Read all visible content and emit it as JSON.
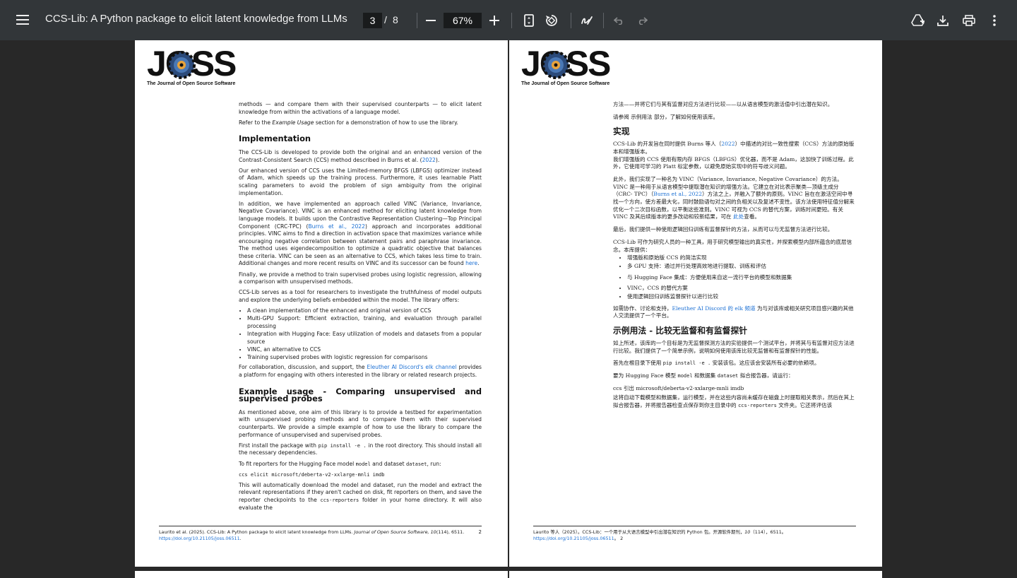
{
  "toolbar": {
    "title": "CCS-Lib: A Python package to elicit latent knowledge from LLMs",
    "page_current": "3",
    "page_sep": "/",
    "page_total": "8",
    "zoom": "67%"
  },
  "logo": {
    "letters": "JOSS",
    "subtitle": "The Journal of Open Source Software"
  },
  "en": {
    "intro_p1": "methods — and compare them with their supervised counterparts — to elicit latent knowledge from within the activations of a language model.",
    "intro_p2_a": "Refer to the ",
    "intro_p2_em": "Example Usage",
    "intro_p2_b": " section for a demonstration of how to use the library.",
    "h_impl": "Implementation",
    "impl_p1_a": "The CCS-Lib is developed to provide both the original and an enhanced version of the Contrast-Consistent Search (CCS) method described in Burns et al. (",
    "impl_p1_link": "2022",
    "impl_p1_b": ").",
    "impl_p2": "Our enhanced version of CCS uses the Limited-memory BFGS (LBFGS) optimizer instead of Adam, which speeds up the training process. Furthermore, it uses learnable Platt scaling parameters to avoid the problem of sign ambiguity from the original implementation.",
    "impl_p3_a": "In addition, we have implemented an approach called VINC (Variance, Invariance, Negative Covariance). VINC is an enhanced method for eliciting latent knowledge from language models. It builds upon the Contrastive Representation Clustering—Top Principal Component (CRC-TPC) (",
    "impl_p3_link": "Burns et al., 2022",
    "impl_p3_b": ") approach and incorporates additional principles. VINC aims to find a direction in activation space that maximizes variance while encouraging negative correlation between statement pairs and paraphrase invariance. The method uses eigendecomposition to optimize a quadratic objective that balances these criteria. VINC can be seen as an alternative to CCS, which takes less time to train. Additional changes and more recent results on VINC and its successor can be found ",
    "impl_p3_link2": "here",
    "impl_p3_c": ".",
    "impl_p4": "Finally, we provide a method to train supervised probes using logistic regression, allowing a comparison with unsupervised methods.",
    "impl_p5": "CCS-Lib serves as a tool for researchers to investigate the truthfulness of model outputs and explore the underlying beliefs embedded within the model. The library offers:",
    "bullets": [
      "A clean implementation of the enhanced and original version of CCS",
      "Multi-GPU Support: Efficient extraction, training, and evaluation through parallel processing",
      "Integration with Hugging Face: Easy utilization of models and datasets from a popular source",
      "VINC, an alternative to CCS",
      "Training supervised probes with logistic regression for comparisons"
    ],
    "collab_a": "For collaboration, discussion, and support, the ",
    "collab_link": "Eleuther AI Discord's elk channel",
    "collab_b": " provides a platform for engaging with others interested in the library or related research projects.",
    "h_example": "Example usage - Comparing unsupervised and supervised probes",
    "ex_p1": "As mentioned above, one aim of this library is to provide a testbed for experimentation with unsupervised probing methods and to compare them with their supervised counterparts. We provide a simple example of how to use the library to compare the performance of unsupervised and supervised probes.",
    "ex_p2_a": "First install the package with ",
    "ex_p2_code": "pip install -e .",
    "ex_p2_b": " in the root directory. This should install all the necessary dependencies.",
    "ex_p3_a": "To fit reporters for the Hugging Face model ",
    "ex_p3_code1": "model",
    "ex_p3_b": " and dataset ",
    "ex_p3_code2": "dataset",
    "ex_p3_c": ", run:",
    "ex_cmd": "ccs elicit microsoft/deberta-v2-xxlarge-mnli imdb",
    "ex_p4_a": "This will automatically download the model and dataset, run the model and extract the relevant representations if they aren't cached on disk, fit reporters on them, and save the reporter checkpoints to the ",
    "ex_p4_code": "ccs-reporters",
    "ex_p4_b": " folder in your home directory. It will also evaluate the",
    "footer_a": "Laurito et al. (2025). CCS-Lib: A Python package to elicit latent knowledge from LLMs. ",
    "footer_journal": "Journal of Open Source Software, 10",
    "footer_b": "(114), 6511. ",
    "footer_doi": "https://doi.org/10.21105/joss.06511",
    "footer_c": ".",
    "footer_num": "2"
  },
  "zh": {
    "intro_p1": "方法——并将它们与其有监督对应方法进行比较——以从语言模型的激活值中引出潜在知识。",
    "intro_p2": "请参阅 示例用法 部分，了解如何使用该库。",
    "h_impl": "实现",
    "impl_p1_a": "CCS-Lib 的开发旨在同时提供 Burns 等人（",
    "impl_p1_link": "2022",
    "impl_p1_b": "）中描述的对比一致性搜索（CCS）方法的原始版本和增强版本。",
    "impl_p2": "我们增强版的 CCS 使用有限内存 BFGS（LBFGS）优化器，而不是 Adam，这加快了训练过程。此外，它使用可学习的 Platt 标定参数，以避免原始实现中的符号歧义问题。",
    "impl_p3_a": "此外，我们实现了一种名为 VINC（Variance, Invariance, Negative Covariance）的方法。VINC 是一种用于从语言模型中提取潜在知识的增强方法。它建立在对比表示聚类—顶级主成分（CRC- TPC）（",
    "impl_p3_link": "Burns et al., 2022",
    "impl_p3_b": "）方法之上，并融入了额外的原则。VINC 旨在在激活空间中寻找一个方向，使方差最大化，同时鼓励语句对之间的负相关以及复述不变性。该方法使用特征值分解来优化一个二次目标函数，以平衡这些准则。VINC 可视为 CCS 的替代方案，训练时间更短。有关 VINC 及其后续版本的更多改动和较新结果，可在 ",
    "impl_p3_link2": "此处",
    "impl_p3_c": "查看。",
    "impl_p4": "最后，我们提供一种使用逻辑回归训练有监督探针的方法，从而可以与无监督方法进行比较。",
    "impl_p5": "CCS-Lib 可作为研究人员的一种工具，用于研究模型输出的真实性，并探索模型内部所蕴含的底层信念。本库提供：",
    "bullets": [
      "增强版和原始版 CCS 的简洁实现",
      "多 GPU 支持：通过并行处理高效地进行提取、训练和评估",
      "与 Hugging Face 集成：方便使用来自这一流行平台的模型和数据集",
      "VINC，CCS 的替代方案",
      "使用逻辑回归训练监督探针以进行比较"
    ],
    "collab_a": "如需协作、讨论和支持，",
    "collab_link": "Eleuther AI Discord 的 elk 频道",
    "collab_b": " 为与对该库或相关研究项目感兴趣的其他人交流提供了一个平台。",
    "h_example": "示例用法 - 比较无监督和有监督探针",
    "ex_p1": "如上所述，该库的一个目标是为无监督探测方法的实验提供一个测试平台，并将其与有监督对应方法进行比较。我们提供了一个简单示例，说明如何使用该库比较无监督和有监督探针的性能。",
    "ex_p2_a": "首先在根目录下使用 ",
    "ex_p2_code": "pip install -e .",
    "ex_p2_b": " 安装该包。这应该会安装所有必要的依赖项。",
    "ex_p3_a": "要为 Hugging Face 模型 ",
    "ex_p3_code1": "model",
    "ex_p3_b": " 和数据集 ",
    "ex_p3_code2": "dataset",
    "ex_p3_c": " 拟合报告器，请运行：",
    "ex_cmd": "ccs 引出 microsoft/deberta-v2-xxlarge-mnli imdb",
    "ex_p4_a": "这将自动下载模型和数据集，运行模型，并在这些内容尚未缓存在磁盘上时提取相关表示，然后在其上拟合报告器，并将报告器检查点保存到你主目录中的 ",
    "ex_p4_code": "ccs-reporters",
    "ex_p4_b": " 文件夹。它还将评估该",
    "footer_a": "Laurito 等人（2025）。CCS-Lib：一个用于从大语言模型中引出潜在知识的 Python 包。开源软件期刊，",
    "footer_journal": "10",
    "footer_b": "（114），6511。",
    "footer_doi": "https://doi.org/10.21105/joss.06511",
    "footer_c": "。",
    "footer_num": "2"
  }
}
